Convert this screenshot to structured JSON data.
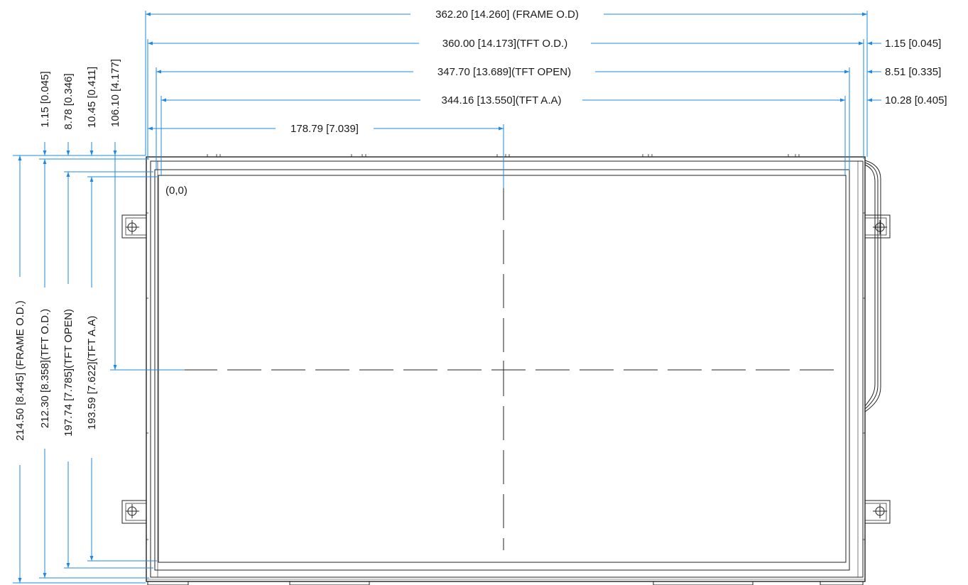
{
  "horizontal_dimensions": {
    "frame_od": "362.20 [14.260] (FRAME O.D)",
    "tft_od": "360.00 [14.173](TFT O.D.)",
    "tft_open": "347.70 [13.689](TFT OPEN)",
    "tft_aa": "344.16 [13.550](TFT A.A)",
    "center_x": "178.79 [7.039]",
    "right_offset_od": "1.15 [0.045]",
    "right_offset_open": "8.51 [0.335]",
    "right_offset_aa": "10.28 [0.405]"
  },
  "vertical_dimensions": {
    "frame_od": "214.50 [8.445] (FRAME O.D.)",
    "tft_od": "212.30 [8.358](TFT O.D.)",
    "tft_open": "197.74 [7.785](TFT OPEN)",
    "tft_aa": "193.59 [7.622](TFT A.A)",
    "top_offset_od": "1.15 [0.045]",
    "top_offset_open": "8.78 [0.346]",
    "top_offset_aa": "10.45 [0.411]",
    "center_y": "106.10 [4.177]"
  },
  "origin_label": "(0,0)",
  "colors": {
    "dimension_line": "#1e88e5",
    "outline": "#222222",
    "text": "#1a1a1a"
  }
}
